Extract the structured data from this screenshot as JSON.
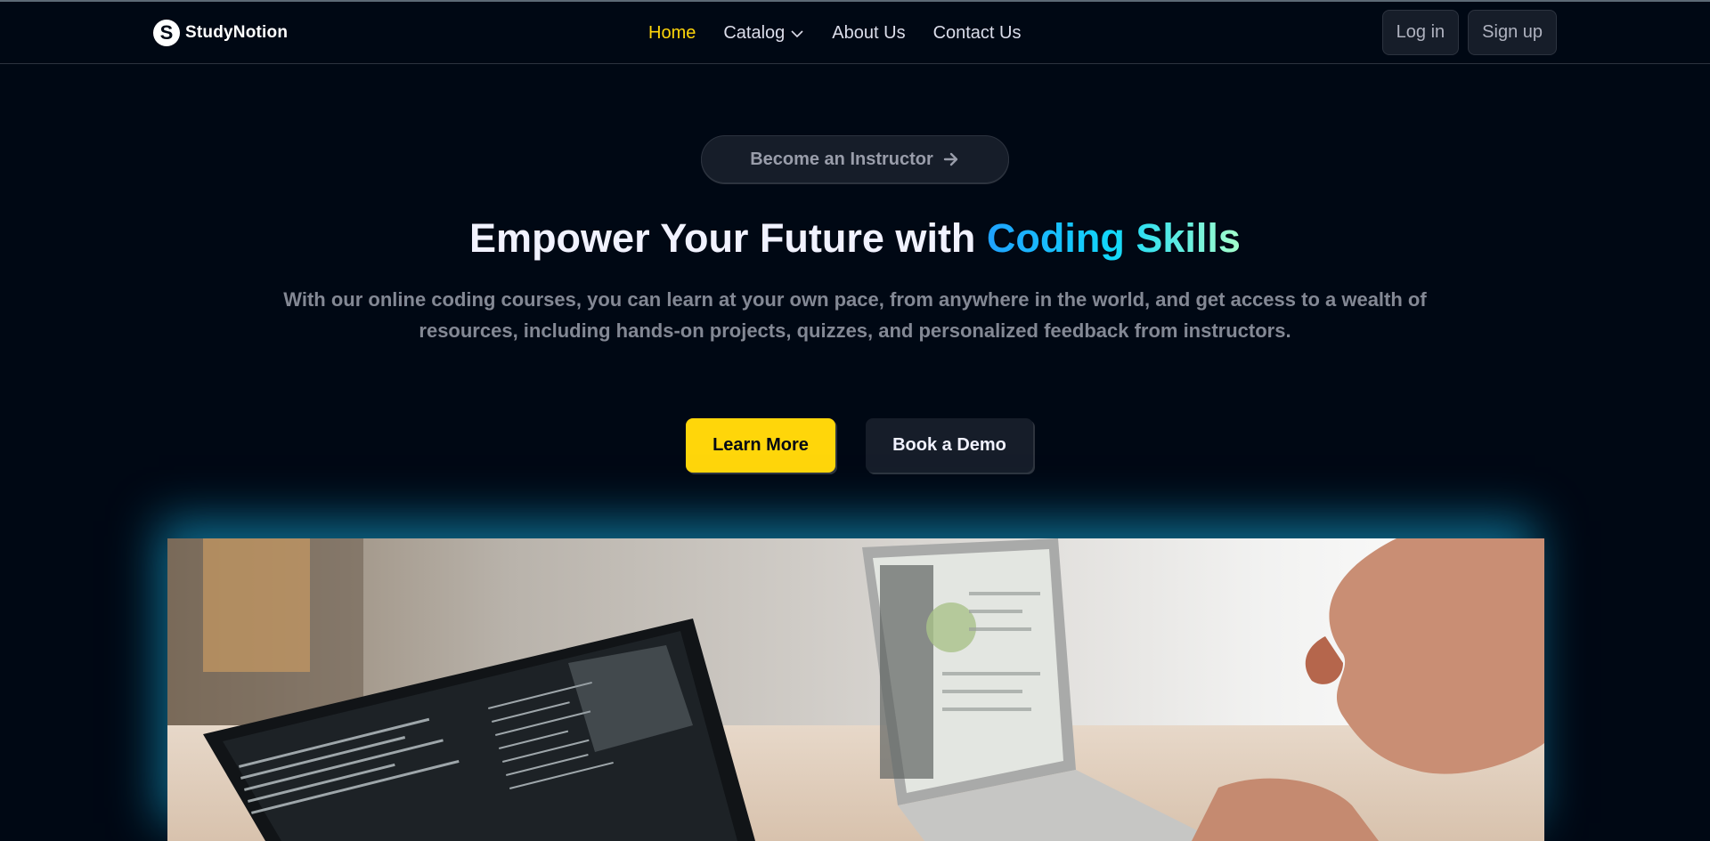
{
  "brand": {
    "name": "StudyNotion",
    "logo_letter": "S"
  },
  "nav": {
    "links": [
      {
        "label": "Home",
        "active": true
      },
      {
        "label": "Catalog",
        "active": false,
        "icon": "chevron-down-icon"
      },
      {
        "label": "About Us",
        "active": false
      },
      {
        "label": "Contact Us",
        "active": false
      }
    ]
  },
  "auth": {
    "login_label": "Log in",
    "signup_label": "Sign up"
  },
  "hero": {
    "pill_label": "Become an Instructor",
    "pill_icon": "arrow-right-icon",
    "title_plain": "Empower Your Future with ",
    "title_highlight": "Coding Skills",
    "subtitle": "With our online coding courses, you can learn at your own pace, from anywhere in the world, and get access to a wealth of resources, including hands-on projects, quizzes, and personalized feedback from instructors.",
    "primary_cta": "Learn More",
    "secondary_cta": "Book a Demo"
  },
  "colors": {
    "background": "#000814",
    "accent_yellow": "#ffd60a",
    "highlight_gradient": [
      "#1fa2ff",
      "#12d8fa",
      "#a6ffcb"
    ],
    "glow": "#118ab2"
  }
}
